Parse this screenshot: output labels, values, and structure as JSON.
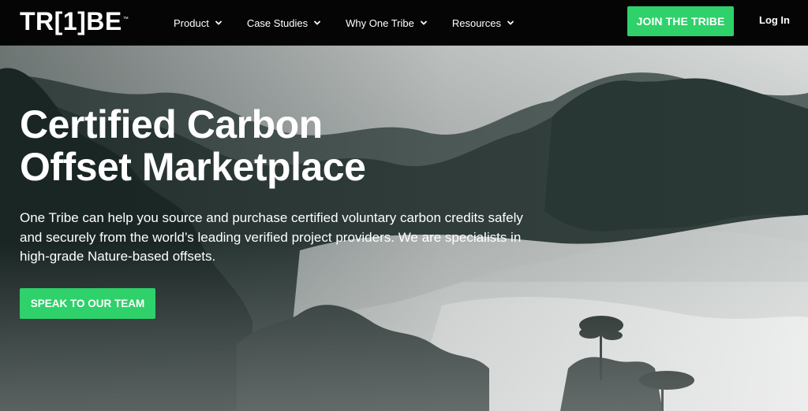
{
  "nav": {
    "logo": "TR[1]BE",
    "logo_mark": "™",
    "menu": [
      {
        "label": "Product"
      },
      {
        "label": "Case Studies"
      },
      {
        "label": "Why One Tribe"
      },
      {
        "label": "Resources"
      }
    ],
    "join_label": "JOIN THE TRIBE",
    "login_label": "Log In"
  },
  "hero": {
    "title_line1": "Certified Carbon",
    "title_line2": "Offset Marketplace",
    "description": "One Tribe can help you source and purchase certified voluntary carbon credits safely and securely from the world’s leading verified project providers. We are specialists in high-grade Nature-based offsets.",
    "cta_label": "SPEAK TO OUR TEAM"
  },
  "colors": {
    "accent": "#2ed16a",
    "nav_bg": "#050505"
  },
  "icons": {
    "dropdown": "chevron-down-icon"
  }
}
